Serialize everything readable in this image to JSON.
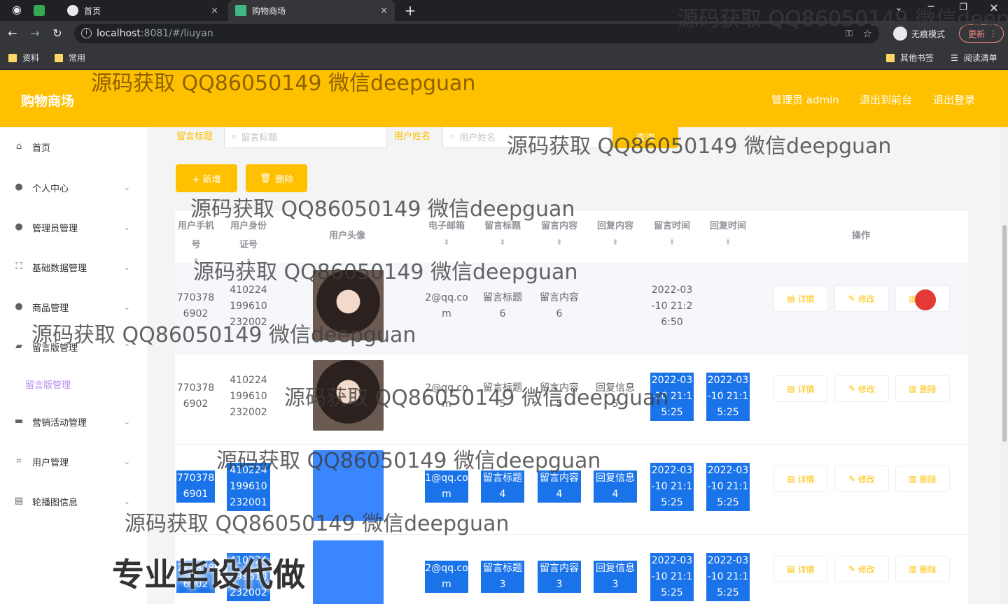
{
  "browser": {
    "tabs": [
      {
        "title": "首页",
        "close": "×"
      },
      {
        "title": "购物商场",
        "close": "×"
      }
    ],
    "new_tab": "+",
    "url_host": "localhost",
    "url_rest": ":8081/#/liuyan",
    "incognito_label": "无痕模式",
    "update_label": "更新",
    "bookmarks": [
      "资料",
      "常用"
    ],
    "bookmarks_right": [
      "其他书签",
      "阅读清单"
    ]
  },
  "header": {
    "brand": "购物商场",
    "admin": "管理员 admin",
    "to_front": "退出到前台",
    "logout": "退出登录"
  },
  "sidebar": {
    "items": [
      {
        "label": "首页",
        "icon": "home-icon"
      },
      {
        "label": "个人中心",
        "icon": "user-icon"
      },
      {
        "label": "管理员管理",
        "icon": "user-icon"
      },
      {
        "label": "基础数据管理",
        "icon": "grid-icon"
      },
      {
        "label": "商品管理",
        "icon": "user-icon"
      },
      {
        "label": "留言版管理",
        "icon": "chat-icon"
      },
      {
        "label": "营销活动管理",
        "icon": "monitor-icon"
      },
      {
        "label": "用户管理",
        "icon": "crop-icon"
      },
      {
        "label": "轮播图信息",
        "icon": "tray-icon"
      }
    ],
    "sub_item": "留言版管理"
  },
  "search": {
    "label1": "留言标题",
    "placeholder1": "留言标题",
    "label2": "用户姓名",
    "placeholder2": "用户姓名",
    "button": "查询"
  },
  "actions": {
    "add": "+ 新增",
    "delete": "删除"
  },
  "table": {
    "headers": [
      "用户手机号",
      "用户身份证号",
      "用户头像",
      "电子邮箱",
      "留言标题",
      "留言内容",
      "回复内容",
      "留言时间",
      "回复时间",
      "操作"
    ],
    "rows": [
      {
        "phone": "7703786902",
        "idcard": "410224199610232002",
        "email": "2@qq.com",
        "title": "留言标题6",
        "content": "留言内容6",
        "reply": "",
        "time": "2022-03-10 21:26:50",
        "reply_time": ""
      },
      {
        "phone": "7703786902",
        "idcard": "410224199610232002",
        "email": "2@qq.com",
        "title": "留言标题5",
        "content": "留言内容5",
        "reply": "回复信息5",
        "time": "2022-03-10 21:15:25",
        "reply_time": "2022-03-10 21:15:25"
      },
      {
        "phone": "7703786901",
        "idcard": "410224199610232001",
        "email": "1@qq.com",
        "title": "留言标题4",
        "content": "留言内容4",
        "reply": "回复信息4",
        "time": "2022-03-10 21:15:25",
        "reply_time": "2022-03-10 21:15:25"
      },
      {
        "phone": "7703786902",
        "idcard": "410224199610232002",
        "email": "2@qq.com",
        "title": "留言标题3",
        "content": "留言内容3",
        "reply": "回复信息3",
        "time": "2022-03-10 21:15:25",
        "reply_time": "2022-03-10 21:15:25"
      }
    ],
    "op_labels": {
      "detail": "详情",
      "edit": "修改",
      "delete": "删除"
    }
  },
  "watermarks": [
    "源码获取 QQ86050149 微信deepguan",
    "专业毕设代做"
  ]
}
